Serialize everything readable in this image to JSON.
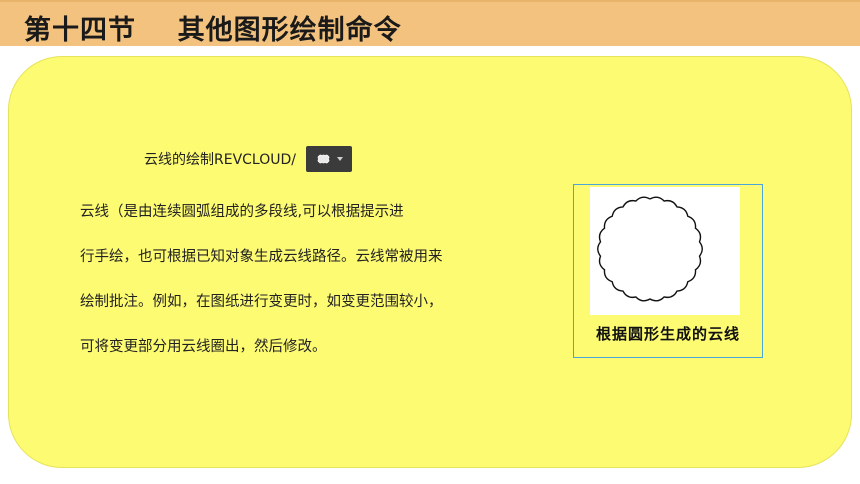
{
  "header": {
    "title": "第十四节    其他图形绘制命令"
  },
  "content": {
    "heading": "云线的绘制REVCLOUD/",
    "tool_icon": "revcloud-tool-icon",
    "paragraph_lines": [
      "    云线（是由连续圆弧组成的多段线,可以根据提示进",
      "行手绘，也可根据已知对象生成云线路径。云线常被用来",
      "绘制批注。例如，在图纸进行变更时，如变更范围较小，",
      "可将变更部分用云线圈出，然后修改。"
    ]
  },
  "figure": {
    "caption": "根据圆形生成的云线",
    "shape": "revision-cloud-circle"
  },
  "colors": {
    "title_bar": "#f3c27e",
    "panel": "#fdfb72",
    "figure_border": "#4aa6d8"
  }
}
